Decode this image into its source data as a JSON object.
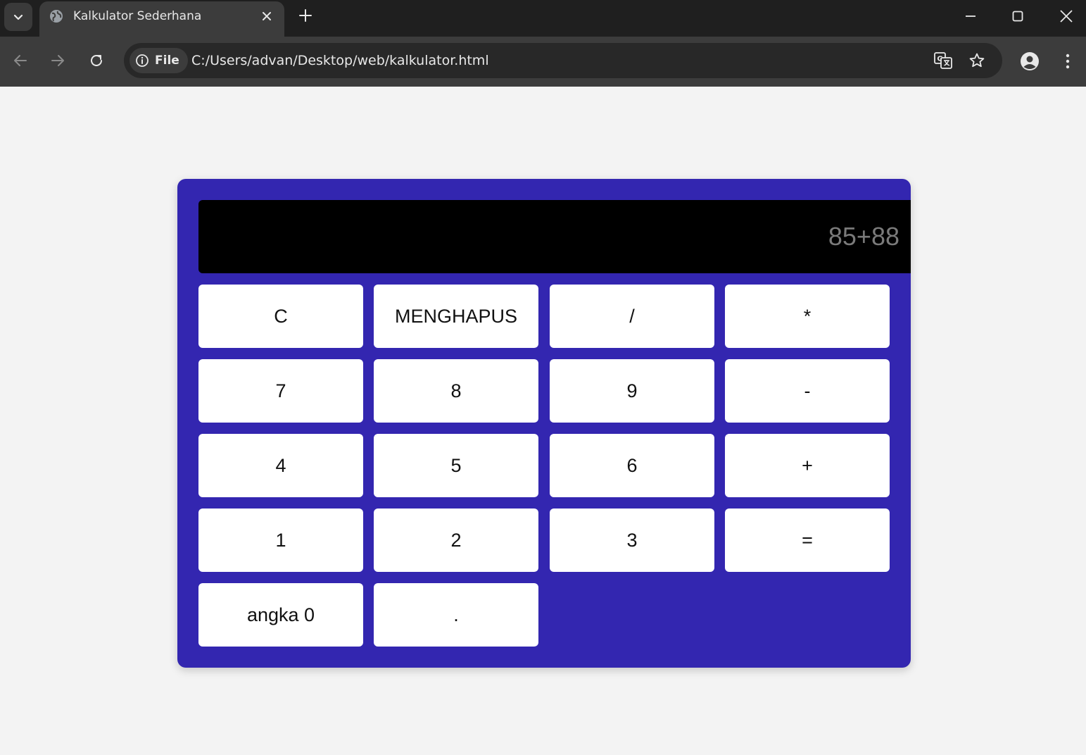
{
  "browser": {
    "tab_title": "Kalkulator Sederhana",
    "site_chip_label": "File",
    "url": "C:/Users/advan/Desktop/web/kalkulator.html",
    "icons": {
      "tab_search": "chevron-down-icon",
      "favicon": "globe-icon",
      "tab_close": "close-icon",
      "new_tab": "plus-icon",
      "minimize": "minimize-icon",
      "maximize": "maximize-icon",
      "close_window": "close-icon",
      "back": "arrow-left-icon",
      "forward": "arrow-right-icon",
      "reload": "reload-icon",
      "site_info": "info-icon",
      "translate": "translate-icon",
      "bookmark": "star-icon",
      "profile": "profile-icon",
      "menu": "more-vertical-icon"
    }
  },
  "calculator": {
    "display_value": "85+88",
    "keys": {
      "clear": "C",
      "delete": "MENGHAPUS",
      "divide": "/",
      "multiply": "*",
      "seven": "7",
      "eight": "8",
      "nine": "9",
      "subtract": "-",
      "four": "4",
      "five": "5",
      "six": "6",
      "add": "+",
      "one": "1",
      "two": "2",
      "three": "3",
      "equals": "=",
      "zero": "angka 0",
      "decimal": "."
    },
    "colors": {
      "panel": "#3326b0",
      "display_background": "#000000",
      "display_text": "#7a7a7a",
      "key_background": "#ffffff",
      "page_background": "#f3f3f3"
    }
  }
}
